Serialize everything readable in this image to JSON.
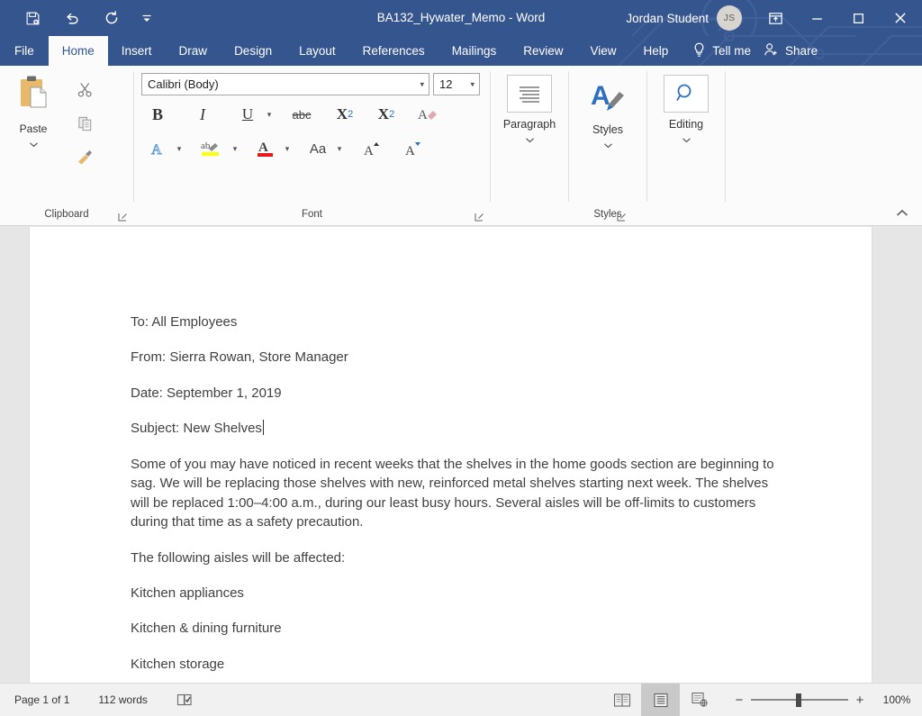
{
  "window": {
    "title": "BA132_Hywater_Memo  -  Word",
    "account_name": "Jordan Student",
    "account_initials": "JS",
    "accent_color": "#35558f",
    "quick_access": [
      {
        "name": "save-icon",
        "label": "Save"
      },
      {
        "name": "undo-icon",
        "label": "Undo"
      },
      {
        "name": "redo-icon",
        "label": "Redo"
      },
      {
        "name": "customize-quick-access-icon",
        "label": "Customize Quick Access Toolbar"
      }
    ],
    "controls": [
      {
        "name": "ribbon-display-options-icon",
        "label": "Ribbon Display Options"
      },
      {
        "name": "minimize-icon",
        "label": "Minimize"
      },
      {
        "name": "maximize-icon",
        "label": "Maximize"
      },
      {
        "name": "close-icon",
        "label": "Close"
      }
    ]
  },
  "tabs": [
    {
      "label": "File",
      "active": false
    },
    {
      "label": "Home",
      "active": true
    },
    {
      "label": "Insert",
      "active": false
    },
    {
      "label": "Draw",
      "active": false
    },
    {
      "label": "Design",
      "active": false
    },
    {
      "label": "Layout",
      "active": false
    },
    {
      "label": "References",
      "active": false
    },
    {
      "label": "Mailings",
      "active": false
    },
    {
      "label": "Review",
      "active": false
    },
    {
      "label": "View",
      "active": false
    },
    {
      "label": "Help",
      "active": false
    }
  ],
  "tellme": {
    "label": "Tell me",
    "icon": "lightbulb-icon"
  },
  "share": {
    "label": "Share",
    "icon": "person-add-icon"
  },
  "ribbon": {
    "clipboard": {
      "group_label": "Clipboard",
      "paste_label": "Paste",
      "buttons": [
        {
          "name": "cut-button",
          "label": "Cut"
        },
        {
          "name": "copy-button",
          "label": "Copy"
        },
        {
          "name": "format-painter-button",
          "label": "Format Painter"
        }
      ]
    },
    "font": {
      "group_label": "Font",
      "font_name": "Calibri (Body)",
      "font_size": "12",
      "bold": "B",
      "italic": "I",
      "underline": "U",
      "strikethrough": "abc",
      "subscript": "X",
      "subscript_sub": "2",
      "superscript": "X",
      "superscript_sup": "2",
      "clear_formatting": "Clear All Formatting",
      "text_effects": "Text Effects and Typography",
      "highlight": "Text Highlight Color",
      "font_color": "Font Color",
      "change_case": "Aa",
      "grow_font": "Increase Font Size",
      "shrink_font": "Decrease Font Size"
    },
    "paragraph": {
      "label": "Paragraph"
    },
    "styles": {
      "label": "Styles",
      "group_label": "Styles"
    },
    "editing": {
      "label": "Editing"
    },
    "collapse_label": "Collapse the Ribbon"
  },
  "document": {
    "paragraphs": [
      "To: All Employees",
      "From: Sierra Rowan, Store Manager",
      "Date: September 1, 2019"
    ],
    "subject_line": "Subject: New Shelves",
    "body": "Some of you may have noticed in recent weeks that the shelves in the home goods section are beginning to sag. We will be replacing those shelves with new, reinforced metal shelves starting next week. The shelves will be replaced 1:00–4:00 a.m., during our least busy hours. Several aisles will be off-limits to customers during that time as a safety precaution.",
    "list_intro": "The following aisles will be affected:",
    "list_items": [
      "Kitchen appliances",
      "Kitchen & dining furniture",
      "Kitchen storage"
    ]
  },
  "statusbar": {
    "page": "Page 1 of 1",
    "words": "112 words",
    "proofing_icon": "proofing-errors-icon",
    "views": [
      {
        "name": "read-mode-button",
        "label": "Read Mode",
        "active": false
      },
      {
        "name": "print-layout-button",
        "label": "Print Layout",
        "active": true
      },
      {
        "name": "web-layout-button",
        "label": "Web Layout",
        "active": false
      }
    ],
    "zoom_out": "−",
    "zoom_in": "+",
    "zoom_level": "100%"
  }
}
